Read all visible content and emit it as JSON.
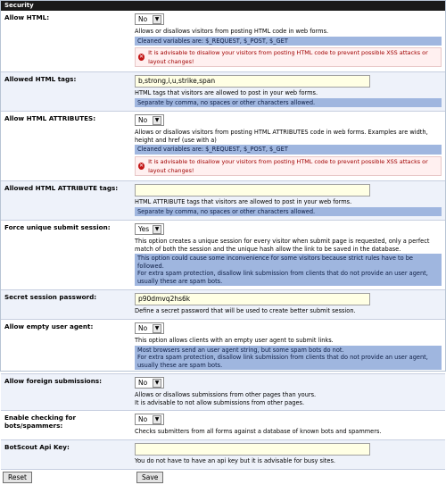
{
  "section_title": "Security",
  "allow_html": {
    "label": "Allow HTML:",
    "value": "No",
    "desc": "Allows or disallows visitors from posting HTML code in web forms.",
    "info": "Cleaned variables are: $_REQUEST, $_POST, $_GET",
    "warning": "It is advisable to disallow your visitors from posting HTML code to prevent possible XSS attacks or layout changes!"
  },
  "allowed_tags": {
    "label": "Allowed HTML tags:",
    "value": "b,strong,i,u,strike,span",
    "desc": "HTML tags that visitors are allowed to post in your web forms.",
    "info": "Separate by comma, no spaces or other characters allowed."
  },
  "allow_attrs": {
    "label": "Allow HTML ATTRIBUTES:",
    "value": "No",
    "desc": "Allows or disallows visitors from posting HTML ATTRIBUTES code in web forms. Examples are width, height and href (use with a)",
    "info": "Cleaned variables are: $_REQUEST, $_POST, $_GET",
    "warning": "It is advisable to disallow your visitors from posting HTML code to prevent possible XSS attacks or layout changes!"
  },
  "allowed_attr_tags": {
    "label": "Allowed HTML ATTRIBUTE tags:",
    "value": "",
    "desc": "HTML ATTRIBUTE tags that visitors are allowed to post in your web forms.",
    "info": "Separate by comma, no spaces or other characters allowed."
  },
  "unique_submit": {
    "label": "Force unique submit session:",
    "value": "Yes",
    "desc": "This option creates a unique session for every visitor when submit page is requested, only a perfect match of both the session and the unique hash allow the link to be saved in the database.",
    "info": "This option could cause some inconvenience for some visitors because strict rules have to be followed.\nFor extra spam protection, disallow link submission from clients that do not provide an user agent, usually these are spam bots."
  },
  "secret_password": {
    "label": "Secret session password:",
    "value": "p90dmvq2hs6k",
    "desc": "Define a secret password that will be used to create better submit session."
  },
  "empty_agent": {
    "label": "Allow empty user agent:",
    "value": "No",
    "desc": "This option allows clients with an empty user agent to submit links.",
    "info": "Most browsers send an user agent string, but some spam bots do not.\nFor extra spam protection, disallow link submission from clients that do not provide an user agent, usually these are spam bots."
  },
  "foreign_submissions": {
    "label": "Allow foreign submissions:",
    "value": "No",
    "desc": "Allows or disallows submissions from other pages than yours.\nIt is advisable to not allow submissions from other pages."
  },
  "bot_check": {
    "label": "Enable checking for bots/spammers:",
    "value": "No",
    "desc": "Checks submitters from all forms against a database of known bots and spammers."
  },
  "botscout": {
    "label": "BotScout Api Key:",
    "value": "",
    "desc": "You do not have to have an api key but it is advisable for busy sites."
  },
  "buttons": {
    "reset": "Reset",
    "save": "Save"
  }
}
